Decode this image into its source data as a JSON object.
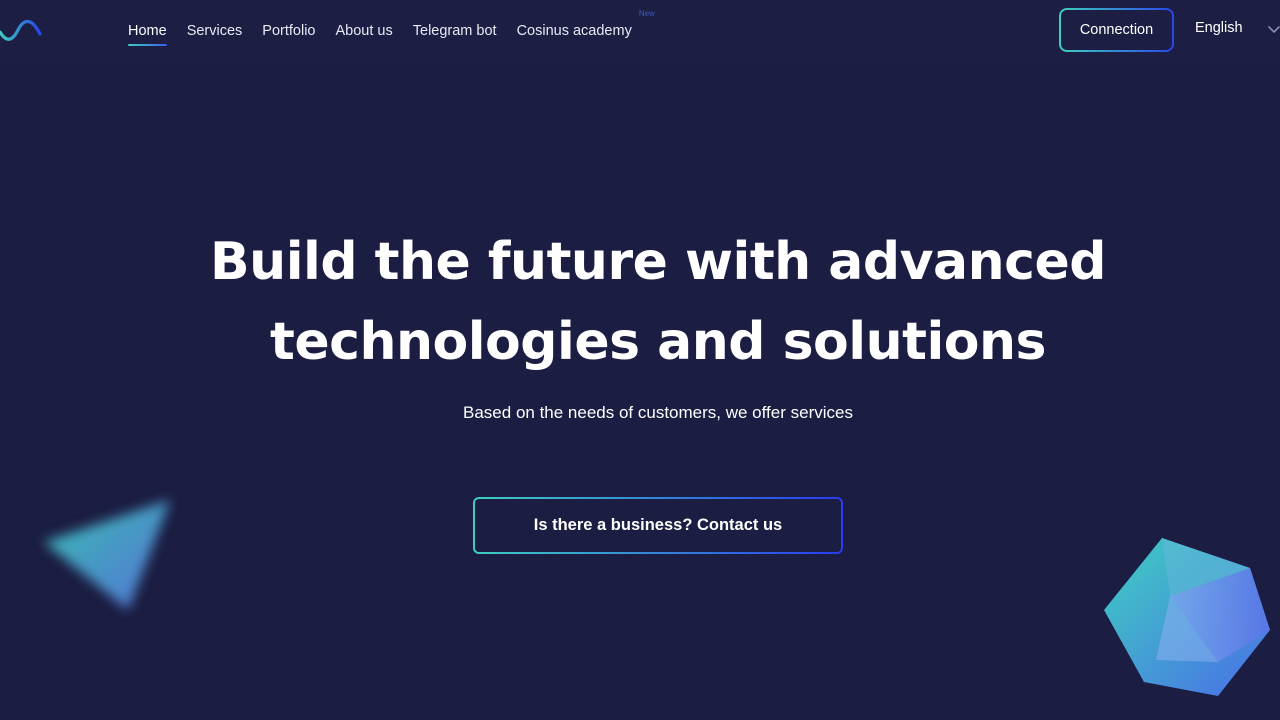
{
  "header": {
    "logo_icon": "wave-logo-icon",
    "nav": [
      {
        "label": "Home",
        "active": true
      },
      {
        "label": "Services",
        "active": false
      },
      {
        "label": "Portfolio",
        "active": false
      },
      {
        "label": "About us",
        "active": false
      },
      {
        "label": "Telegram bot",
        "active": false
      },
      {
        "label": "Cosinus academy",
        "active": false,
        "badge": "New"
      }
    ],
    "connect_label": "Connection",
    "language_label": "English",
    "language_icon": "chevron-down-icon"
  },
  "hero": {
    "title_line1": "Build the future with advanced",
    "title_line2": "technologies and solutions",
    "subtitle": "Based on the needs of customers, we offer services",
    "cta_label": "Is there a business? Contact us"
  },
  "colors": {
    "background": "#1b1d42",
    "accent_teal": "#3ecfc0",
    "accent_blue": "#2a46e8",
    "text": "#ffffff"
  }
}
